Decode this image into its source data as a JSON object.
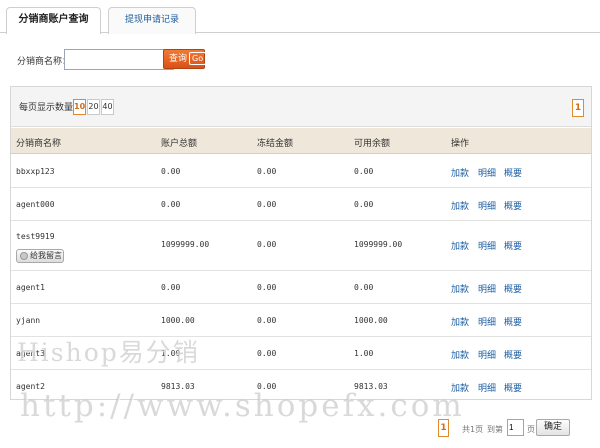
{
  "tabs": [
    {
      "label": "分销商账户查询",
      "active": true
    },
    {
      "label": "提现申请记录",
      "active": false
    }
  ],
  "search": {
    "label": "分销商名称：",
    "value": "",
    "button_label": "查询",
    "button_go": "Go"
  },
  "pagination": {
    "per_page_label": "每页显示数量：",
    "options": [
      "10",
      "20",
      "40"
    ],
    "selected": "10",
    "current_page": "1"
  },
  "table": {
    "headers": [
      "分销商名称",
      "账户总额",
      "冻结金额",
      "可用余额",
      "操作"
    ],
    "rows": [
      {
        "name": "bbxxp123",
        "total": "0.00",
        "frozen": "0.00",
        "available": "0.00"
      },
      {
        "name": "agent000",
        "total": "0.00",
        "frozen": "0.00",
        "available": "0.00"
      },
      {
        "name": "test9919",
        "total": "1099999.00",
        "frozen": "0.00",
        "available": "1099999.00",
        "message_button": "给我留言"
      },
      {
        "name": "agent1",
        "total": "0.00",
        "frozen": "0.00",
        "available": "0.00"
      },
      {
        "name": "yjann",
        "total": "1000.00",
        "frozen": "0.00",
        "available": "1000.00"
      },
      {
        "name": "agent3",
        "total": "1.00",
        "frozen": "0.00",
        "available": "1.00"
      },
      {
        "name": "agent2",
        "total": "9813.03",
        "frozen": "0.00",
        "available": "9813.03"
      }
    ],
    "actions": [
      "加款",
      "明细",
      "概要"
    ]
  },
  "pager": {
    "page": "1",
    "total_text": "共1页",
    "goto_label": "到第",
    "input_value": "1",
    "page_unit": "页",
    "confirm_label": "确定"
  },
  "watermark": {
    "line1": "Hishop易分销",
    "line2": "http://www.shopefx.com"
  },
  "colors": {
    "accent": "#d9511a",
    "link": "#1d5fa3",
    "header_bg": "#efe8da"
  }
}
